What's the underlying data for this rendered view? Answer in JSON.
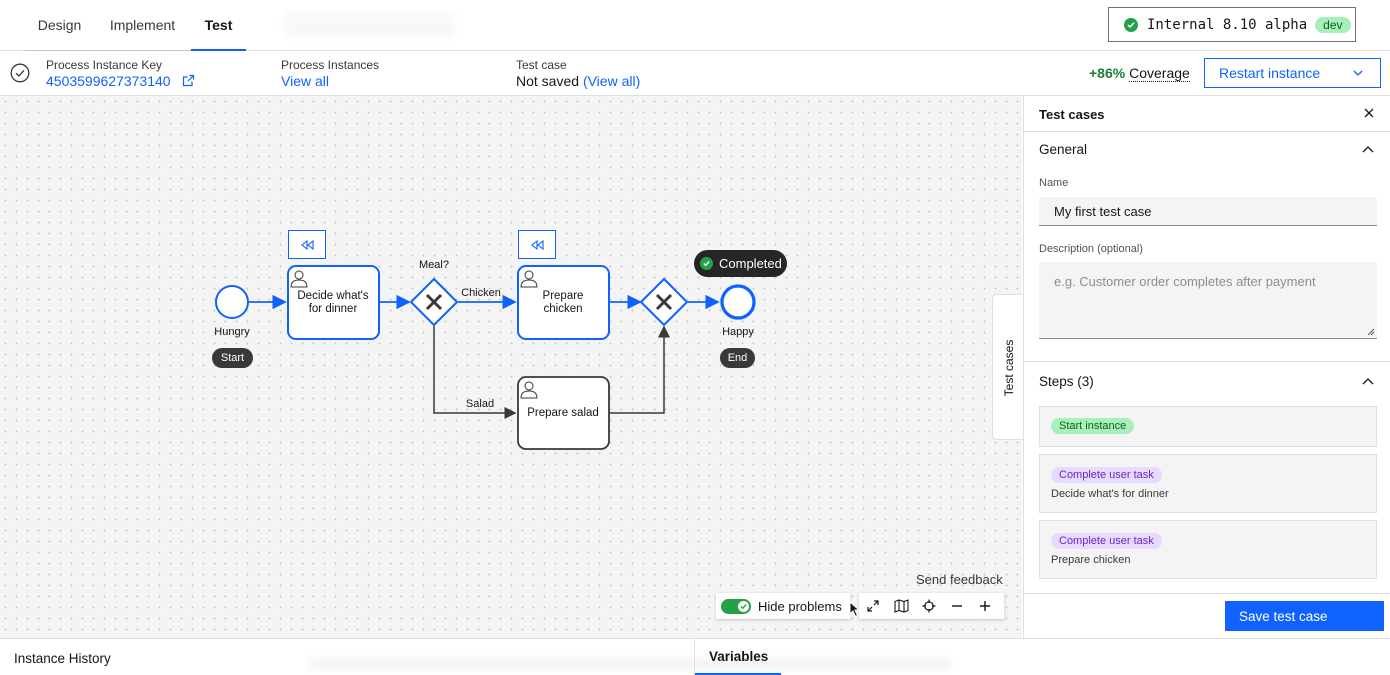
{
  "tabs": [
    {
      "label": "Design"
    },
    {
      "label": "Implement"
    },
    {
      "label": "Test",
      "active": true
    }
  ],
  "environment": {
    "name": "Internal 8.10 alpha",
    "badge": "dev",
    "status_icon": "check-circle-icon"
  },
  "info": {
    "instance_key_label": "Process Instance Key",
    "instance_key": "4503599627373140",
    "instances_label": "Process Instances",
    "instances_link": "View all",
    "test_case_label": "Test case",
    "test_case_value": "Not saved",
    "test_case_link": "(View all)",
    "coverage_pct": "+86%",
    "coverage_label": "Coverage",
    "restart_label": "Restart instance"
  },
  "diagram": {
    "start_event_label": "Hungry",
    "start_badge": "Start",
    "task1": "Decide what's for dinner",
    "task1_lines": [
      "Decide what's",
      "for dinner"
    ],
    "gateway1_label": "Meal?",
    "flow_chicken": "Chicken",
    "flow_salad": "Salad",
    "task2_lines": [
      "Prepare",
      "chicken"
    ],
    "task3": "Prepare salad",
    "end_event_label": "Happy",
    "end_badge": "End",
    "completed_badge": "Completed"
  },
  "side_tab": "Test cases",
  "controls": {
    "send_feedback": "Send feedback",
    "hide_problems": "Hide problems",
    "icons": [
      "fullscreen-icon",
      "minimap-icon",
      "crosshair-icon",
      "zoom-out-icon",
      "zoom-in-icon"
    ]
  },
  "panel": {
    "title": "Test cases",
    "general_title": "General",
    "name_label": "Name",
    "name_value": "My first test case",
    "description_label": "Description (optional)",
    "description_placeholder": "e.g. Customer order completes after payment",
    "steps_title": "Steps (3)",
    "steps": [
      {
        "tag": "Start instance",
        "kind": "green",
        "detail": ""
      },
      {
        "tag": "Complete user task",
        "kind": "purple",
        "detail": "Decide what's for dinner"
      },
      {
        "tag": "Complete user task",
        "kind": "purple",
        "detail": "Prepare chicken"
      }
    ],
    "save_label": "Save test case"
  },
  "bottom": {
    "instance_history": "Instance History",
    "variables": "Variables"
  },
  "colors": {
    "accent": "#0f62fe",
    "success": "#24a148",
    "coverage_text": "#198038",
    "purple_tag_bg": "#e8daff",
    "green_tag_bg": "#a7f0ba"
  }
}
